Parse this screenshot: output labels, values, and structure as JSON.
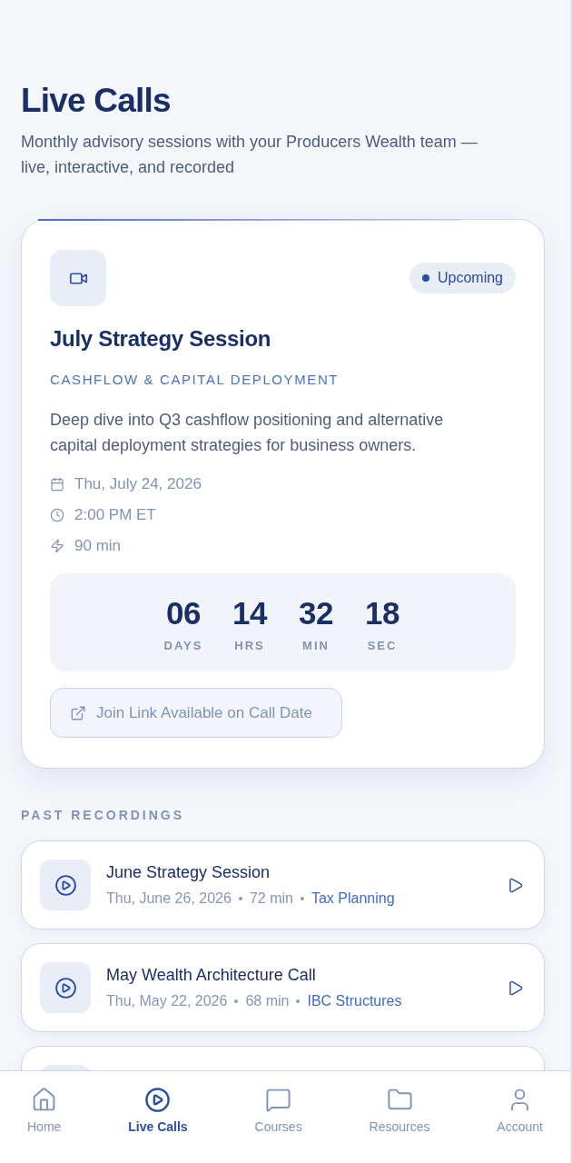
{
  "header": {
    "title": "Live Calls",
    "subtitle": "Monthly advisory sessions with your Producers Wealth team — live, interactive, and recorded"
  },
  "next_call": {
    "status": "Upcoming",
    "title": "July Strategy Session",
    "category": "CASHFLOW & CAPITAL DEPLOYMENT",
    "description": "Deep dive into Q3 cashflow positioning and alternative capital deployment strategies for business owners.",
    "details": [
      {
        "kind": "date",
        "text": "Thu, July 24, 2026"
      },
      {
        "kind": "time",
        "text": "2:00 PM ET"
      },
      {
        "kind": "duration",
        "text": "90 min"
      }
    ],
    "countdown": [
      {
        "value": "06",
        "unit": "DAYS"
      },
      {
        "value": "14",
        "unit": "HRS"
      },
      {
        "value": "32",
        "unit": "MIN"
      },
      {
        "value": "18",
        "unit": "SEC"
      }
    ],
    "join_button": {
      "label": "Join Link Available on Call Date",
      "disabled": true
    }
  },
  "past_recordings": {
    "heading": "PAST RECORDINGS",
    "items": [
      {
        "title": "June Strategy Session",
        "date": "Thu, June 26, 2026",
        "duration": "72 min",
        "topic": "Tax Planning"
      },
      {
        "title": "May Wealth Architecture Call",
        "date": "Thu, May 22, 2026",
        "duration": "68 min",
        "topic": "IBC Structures"
      }
    ],
    "more_below": true
  },
  "nav": [
    {
      "kind": "home",
      "label": "Home",
      "selected": false
    },
    {
      "kind": "calls",
      "label": "Live Calls",
      "selected": true
    },
    {
      "kind": "courses",
      "label": "Courses",
      "selected": false
    },
    {
      "kind": "resources",
      "label": "Resources",
      "selected": false
    },
    {
      "kind": "account",
      "label": "Account",
      "selected": false
    }
  ]
}
